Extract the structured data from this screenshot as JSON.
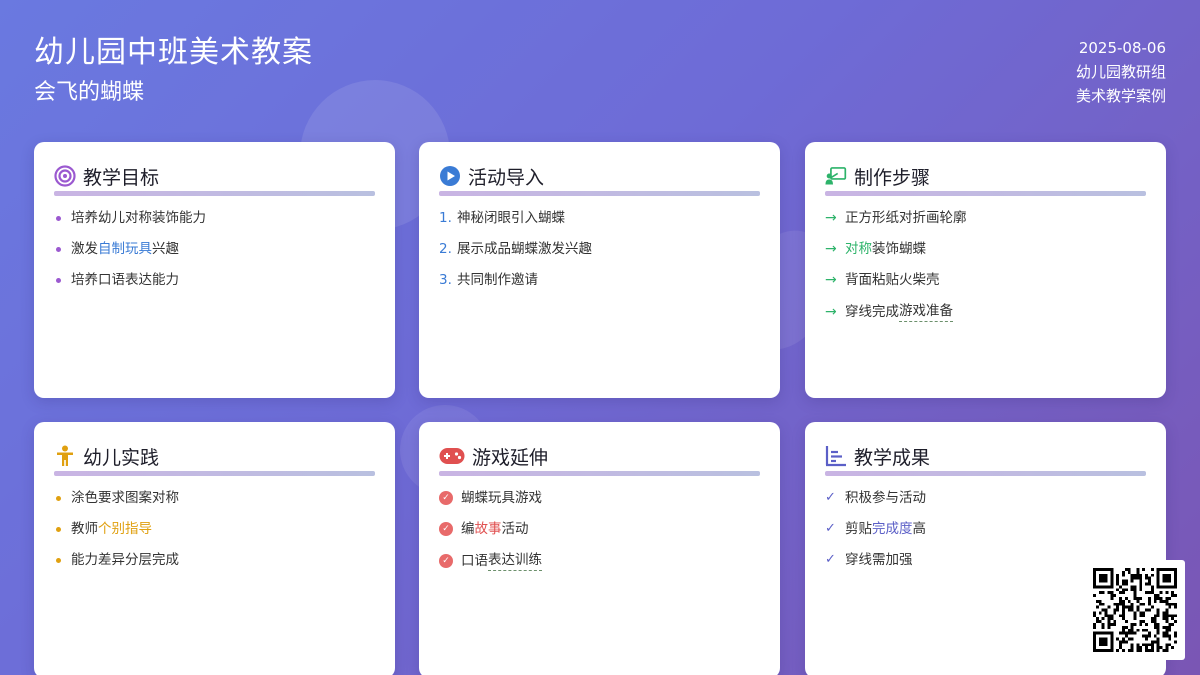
{
  "header": {
    "title": "幼儿园中班美术教案",
    "subtitle": "会飞的蝴蝶",
    "date": "2025-08-06",
    "org": "幼儿园教研组",
    "category": "美术教学案例"
  },
  "cards": {
    "goals": {
      "title": "教学目标",
      "items": [
        {
          "pre": "培养幼儿对称装饰能力",
          "hl": "",
          "post": ""
        },
        {
          "pre": "激发",
          "hl": "自制玩具",
          "post": "兴趣"
        },
        {
          "pre": "培养口语表达能力",
          "hl": "",
          "post": ""
        }
      ]
    },
    "intro": {
      "title": "活动导入",
      "items": [
        {
          "num": "1.",
          "text": "神秘闭眼引入蝴蝶"
        },
        {
          "num": "2.",
          "text": "展示成品蝴蝶激发兴趣"
        },
        {
          "num": "3.",
          "text": "共同制作邀请"
        }
      ]
    },
    "steps": {
      "title": "制作步骤",
      "items": [
        {
          "pre": "正方形纸对折画轮廓",
          "hl": "",
          "post": ""
        },
        {
          "pre": "",
          "hl": "对称",
          "post": "装饰蝴蝶"
        },
        {
          "pre": "背面粘贴火柴壳",
          "hl": "",
          "post": ""
        },
        {
          "pre": "穿线完成",
          "hl": "",
          "post": "游戏准备"
        }
      ]
    },
    "practice": {
      "title": "幼儿实践",
      "items": [
        {
          "pre": "涂色要求图案对称",
          "hl": "",
          "post": ""
        },
        {
          "pre": "教师",
          "hl": "个别指导",
          "post": ""
        },
        {
          "pre": "能力差异分层完成",
          "hl": "",
          "post": ""
        }
      ]
    },
    "games": {
      "title": "游戏延伸",
      "items": [
        {
          "pre": "蝴蝶玩具游戏",
          "hl": "",
          "post": ""
        },
        {
          "pre": "编",
          "hl": "故事",
          "post": "活动"
        },
        {
          "pre": "口语",
          "hl": "",
          "post": "表达训练"
        }
      ]
    },
    "results": {
      "title": "教学成果",
      "items": [
        {
          "pre": "积极参与活动",
          "hl": "",
          "post": ""
        },
        {
          "pre": "剪贴",
          "hl": "完成度",
          "post": "高"
        },
        {
          "pre": "穿线需加强",
          "hl": "",
          "post": ""
        }
      ]
    }
  },
  "colors": {
    "bg_start": "#6a79e0",
    "bg_end": "#7a56b4",
    "goal_dot": "#9b59d0",
    "practice_dot": "#e0a010",
    "step_arrow": "#2db36a",
    "game_check": "#e86a6a",
    "result_check": "#5b5fc7"
  },
  "icons": {
    "goals": "target-icon",
    "intro": "play-icon",
    "steps": "presentation-icon",
    "practice": "child-icon",
    "games": "gamepad-icon",
    "results": "bar-list-icon",
    "qr": "qr-code-icon"
  }
}
